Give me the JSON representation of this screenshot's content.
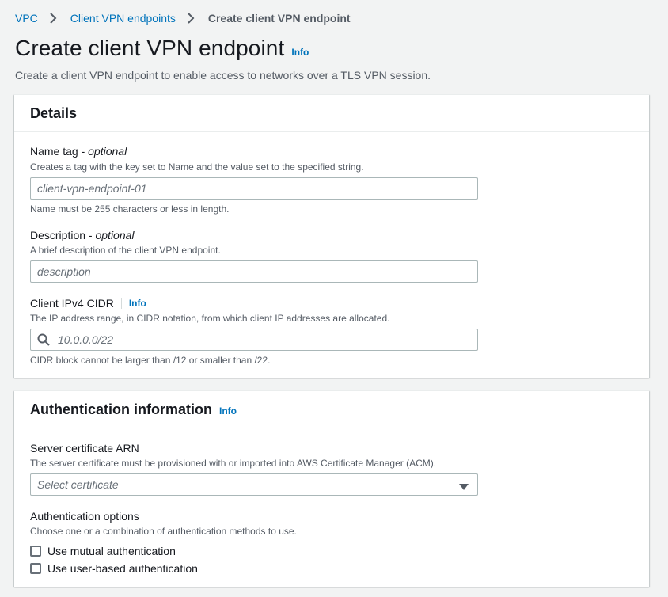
{
  "breadcrumb": {
    "items": [
      "VPC",
      "Client VPN endpoints"
    ],
    "current": "Create client VPN endpoint"
  },
  "page": {
    "title": "Create client VPN endpoint",
    "info": "Info",
    "description": "Create a client VPN endpoint to enable access to networks over a TLS VPN session."
  },
  "details": {
    "heading": "Details",
    "name_tag": {
      "label": "Name tag - ",
      "optional": "optional",
      "description": "Creates a tag with the key set to Name and the value set to the specified string.",
      "placeholder": "client-vpn-endpoint-01",
      "constraint": "Name must be 255 characters or less in length."
    },
    "description_field": {
      "label": "Description - ",
      "optional": "optional",
      "description": "A brief description of the client VPN endpoint.",
      "placeholder": "description"
    },
    "cidr": {
      "label": "Client IPv4 CIDR",
      "info": "Info",
      "description": "The IP address range, in CIDR notation, from which client IP addresses are allocated.",
      "placeholder": "10.0.0.0/22",
      "constraint": "CIDR block cannot be larger than /12 or smaller than /22.",
      "icon": "search-icon"
    }
  },
  "auth": {
    "heading": "Authentication information",
    "info": "Info",
    "server_cert": {
      "label": "Server certificate ARN",
      "description": "The server certificate must be provisioned with or imported into AWS Certificate Manager (ACM).",
      "placeholder": "Select certificate",
      "icon": "caret-down-icon"
    },
    "options": {
      "label": "Authentication options",
      "description": "Choose one or a combination of authentication methods to use.",
      "items": [
        "Use mutual authentication",
        "Use user-based authentication"
      ]
    }
  },
  "colors": {
    "link": "#0073bb",
    "background": "#f2f3f3",
    "text": "#16191f",
    "secondary_text": "#545b64"
  }
}
